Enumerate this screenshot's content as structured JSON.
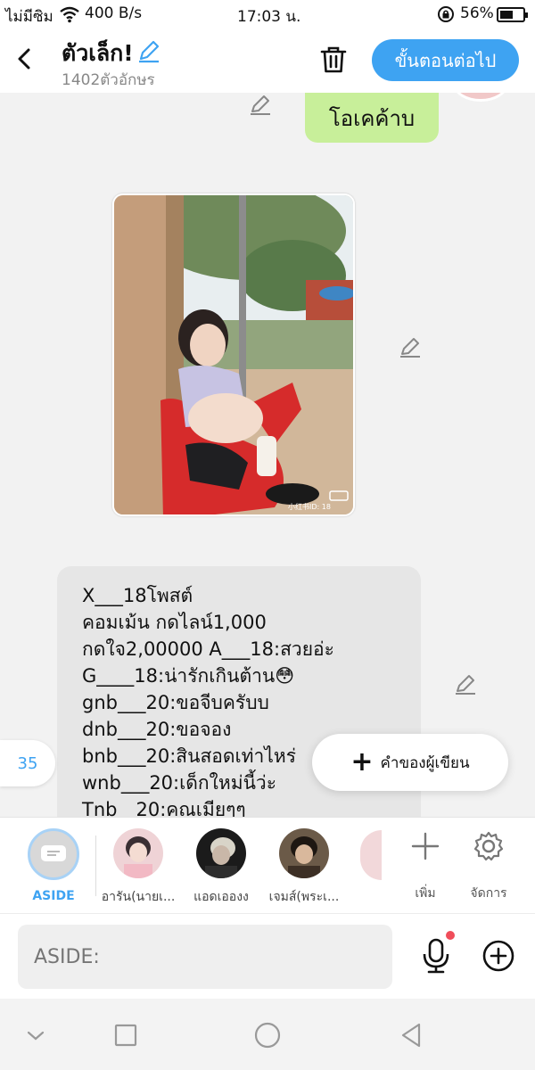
{
  "status_bar": {
    "carrier": "ไม่มีซิม",
    "speed": "400 B/s",
    "time": "17:03 น.",
    "battery": "56%"
  },
  "header": {
    "title": "ตัวเล็ก!",
    "char_count": "1402ตัวอักษร",
    "next_label": "ขั้นตอนต่อไป"
  },
  "chat": {
    "green_bubble": "โอเคค้าบ",
    "photo_watermark": "小红书ID: 18",
    "text_lines": [
      "X___18โพสต์",
      "คอมเม้น   กดไลน์1,000",
      "กดใจ2,00000 A___18:สวยอ่ะ",
      "G____18:น่ารักเกินต้าน😳",
      "gnb___20:ขอจีบครับบ",
      "dnb___20:ขอจอง",
      "bnb___20:สินสอดเท่าไหร่",
      "wnb___20:เด็กใหม่นี้ว่ะ",
      "Tnb__20:คุณเมียๆๆ"
    ],
    "page_badge": "35",
    "author_button": "คำของผู้เขียน"
  },
  "characters": {
    "aside_label": "ASIDE",
    "items": [
      {
        "name": "อารัน(นายเ..."
      },
      {
        "name": "แอดเอองง"
      },
      {
        "name": "เจมส์(พระเ..."
      }
    ],
    "add_label": "เพิ่ม",
    "manage_label": "จัดการ"
  },
  "composer": {
    "placeholder": "ASIDE:"
  },
  "colors": {
    "accent": "#3ea3f2",
    "green_bubble": "#c8ef9a",
    "text_bubble": "#e6e6e6",
    "background": "#f2f2f2"
  }
}
